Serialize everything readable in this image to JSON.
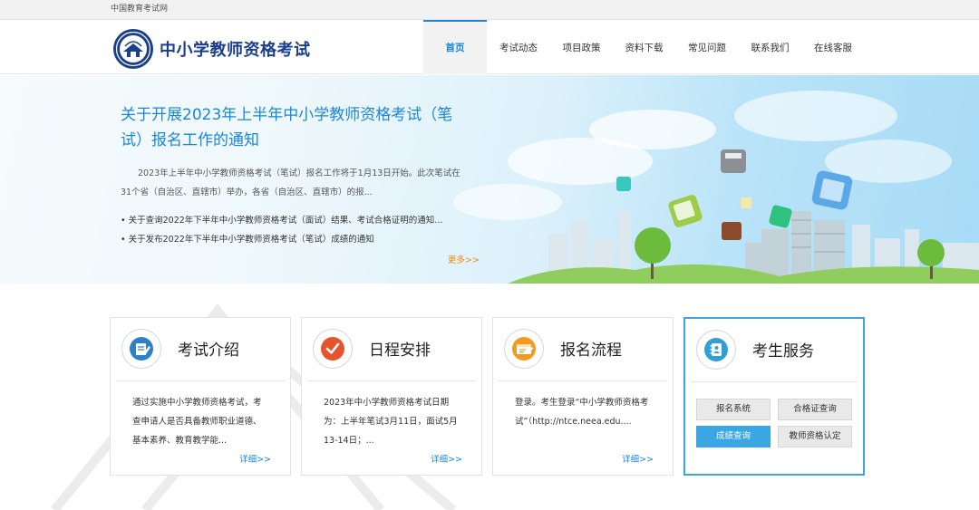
{
  "topbar": {
    "text": "中国教育考试网"
  },
  "header": {
    "site_title": "中小学教师资格考试",
    "nav": [
      {
        "label": "首页",
        "active": true,
        "w": 70
      },
      {
        "label": "考试动态",
        "w": 70
      },
      {
        "label": "项目政策",
        "w": 69
      },
      {
        "label": "资料下载",
        "w": 69
      },
      {
        "label": "常见问题",
        "w": 70
      },
      {
        "label": "联系我们",
        "w": 69
      },
      {
        "label": "在线客服",
        "w": 70
      }
    ]
  },
  "news": {
    "title": "关于开展2023年上半年中小学教师资格考试（笔试）报名工作的通知",
    "summary": "2023年上半年中小学教师资格考试（笔试）报名工作将于1月13日开始。此次笔试在31个省（自治区、直辖市）举办，各省（自治区、直辖市）的报...",
    "items": [
      "关于查询2022年下半年中小学教师资格考试（面试）结果、考试合格证明的通知...",
      "关于发布2022年下半年中小学教师资格考试（笔试）成绩的通知"
    ],
    "more": "更多>>"
  },
  "cards": [
    {
      "title": "考试介绍",
      "body": "通过实施中小学教师资格考试，考查申请人是否具备教师职业道德、基本素养、教育教学能...",
      "link": "详细>>"
    },
    {
      "title": "日程安排",
      "body": "2023年中小学教师资格考试日期为：上半年笔试3月11日，面试5月13-14日；...",
      "link": "详细>>"
    },
    {
      "title": "报名流程",
      "body": "登录。考生登录“中小学教师资格考试”（http://ntce.neea.edu....",
      "link": "详细>>"
    },
    {
      "title": "考生服务"
    }
  ],
  "services": {
    "buttons": [
      "报名系统",
      "合格证查询",
      "成绩查询",
      "教师资格认定"
    ],
    "highlighted": "成绩查询"
  },
  "colors": {
    "accent": "#1a87d8",
    "brand": "#1c3f8c",
    "more": "#f08a00",
    "service_highlight": "#3aa6e2"
  },
  "icons": [
    "logo-emblem",
    "document-edit-icon",
    "checkmark-icon",
    "registration-form-icon",
    "contact-book-icon"
  ]
}
